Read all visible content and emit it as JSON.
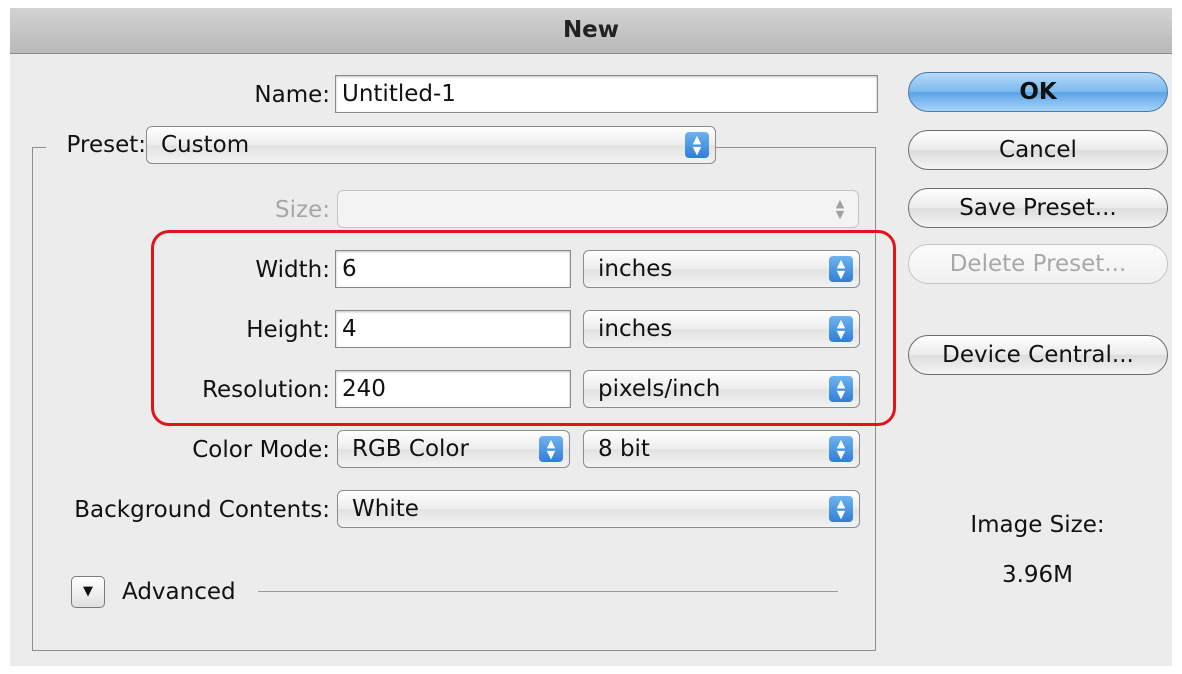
{
  "window": {
    "title": "New"
  },
  "form": {
    "name_label": "Name:",
    "name_value": "Untitled-1",
    "preset_label": "Preset:",
    "preset_value": "Custom",
    "size_label": "Size:",
    "size_value": "",
    "width_label": "Width:",
    "width_value": "6",
    "width_unit": "inches",
    "height_label": "Height:",
    "height_value": "4",
    "height_unit": "inches",
    "resolution_label": "Resolution:",
    "resolution_value": "240",
    "resolution_unit": "pixels/inch",
    "color_mode_label": "Color Mode:",
    "color_mode_value": "RGB Color",
    "bit_depth_value": "8 bit",
    "background_label": "Background Contents:",
    "background_value": "White",
    "advanced_label": "Advanced"
  },
  "buttons": {
    "ok": "OK",
    "cancel": "Cancel",
    "save_preset": "Save Preset...",
    "delete_preset": "Delete Preset...",
    "device_central": "Device Central..."
  },
  "image_size": {
    "label": "Image Size:",
    "value": "3.96M"
  },
  "colors": {
    "highlight": "#e2141a",
    "accent": "#4a90e2"
  }
}
